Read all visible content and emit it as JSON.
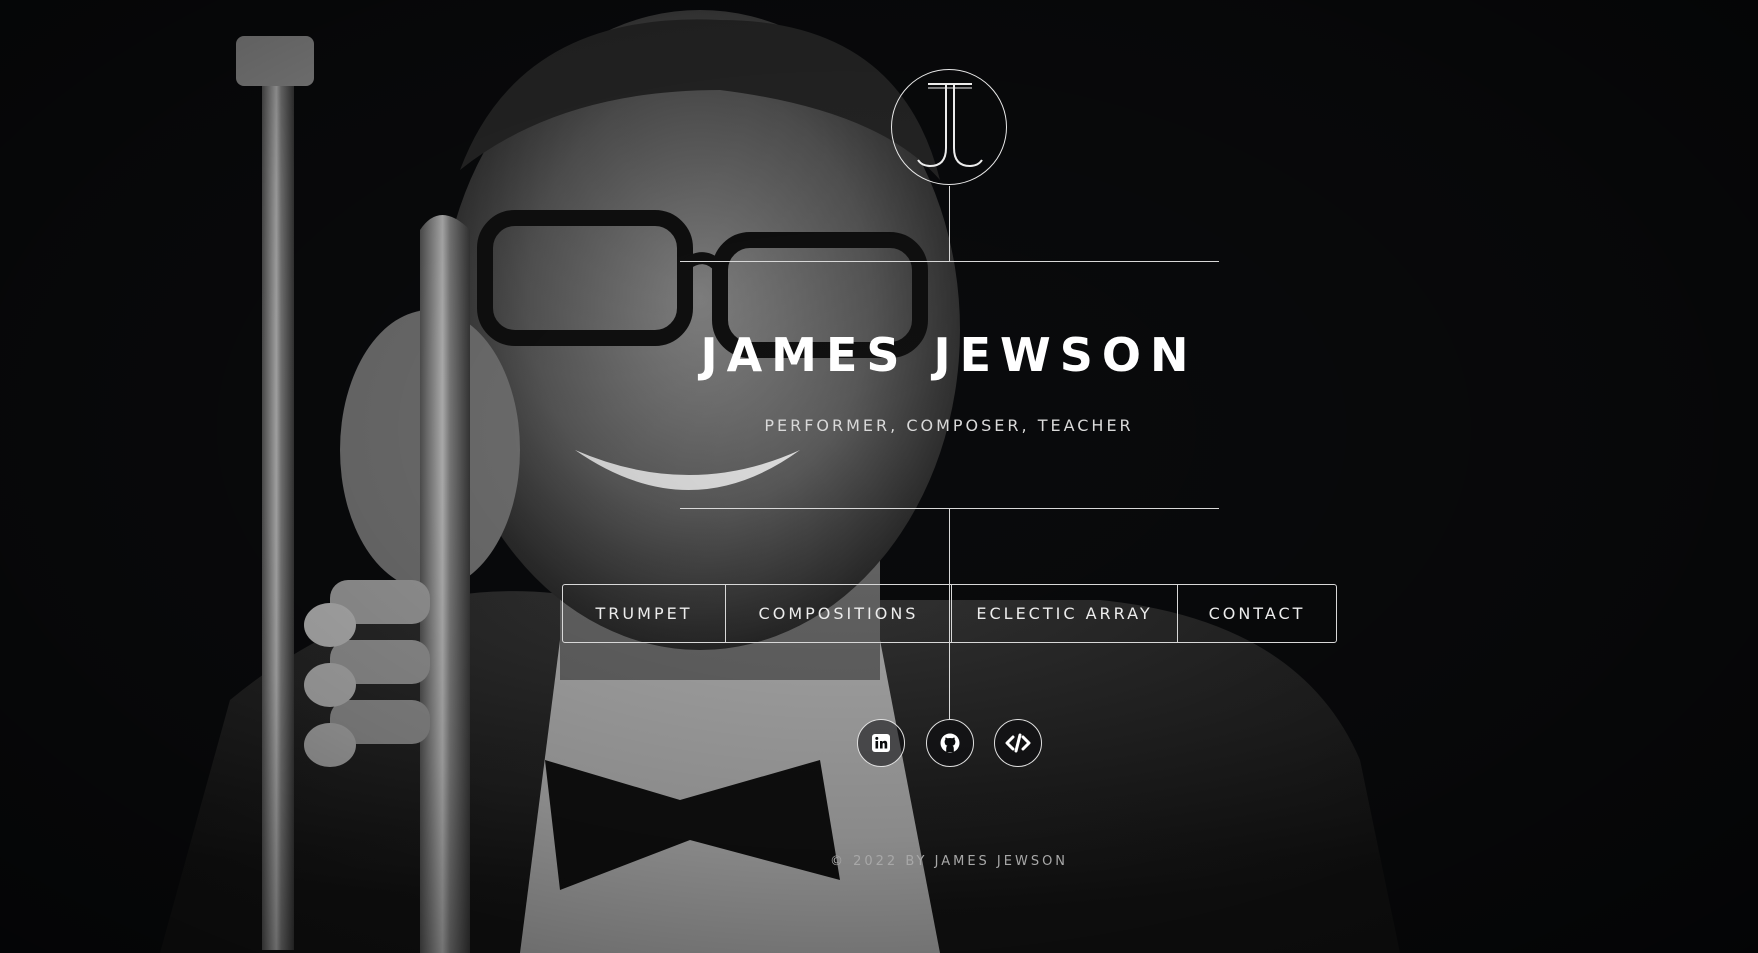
{
  "site": {
    "title": "JAMES JEWSON",
    "subtitle": "PERFORMER, COMPOSER, TEACHER",
    "logo_initials": "JJ"
  },
  "nav": {
    "items": [
      {
        "label": "TRUMPET"
      },
      {
        "label": "COMPOSITIONS"
      },
      {
        "label": "ECLECTIC ARRAY"
      },
      {
        "label": "CONTACT"
      }
    ]
  },
  "social": [
    {
      "icon": "linkedin-icon"
    },
    {
      "icon": "github-icon"
    },
    {
      "icon": "code-icon"
    }
  ],
  "footer": {
    "copyright": "© 2022 BY JAMES JEWSON"
  },
  "colors": {
    "background": "#0a0b0d",
    "text": "#ffffff",
    "lines": "#d8d8d8"
  }
}
